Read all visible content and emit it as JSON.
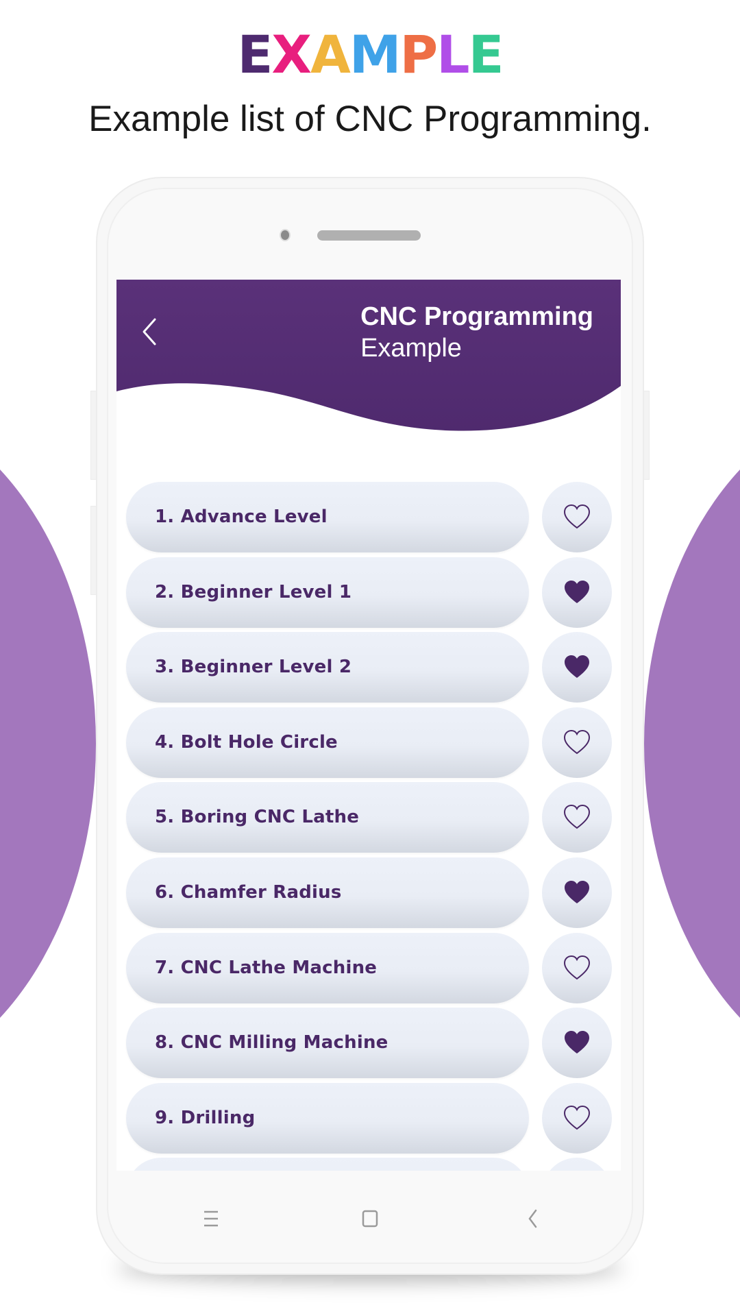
{
  "promo": {
    "title_letters": [
      {
        "char": "E",
        "color": "#4e2a6f"
      },
      {
        "char": "X",
        "color": "#e81f7e"
      },
      {
        "char": "A",
        "color": "#f0b43c"
      },
      {
        "char": "M",
        "color": "#3fa2e8"
      },
      {
        "char": "P",
        "color": "#ee6e45"
      },
      {
        "char": "L",
        "color": "#b04ee8"
      },
      {
        "char": "E",
        "color": "#35c991"
      }
    ],
    "subtitle": "Example list of CNC Programming."
  },
  "colors": {
    "header_purple": "#532b72",
    "accent_text": "#4a2867",
    "background_blob": "#a377bd",
    "pill_bg": "#eaeef6"
  },
  "app": {
    "header": {
      "back_icon": "chevron-left-icon",
      "title": "CNC Programming",
      "subtitle": "Example"
    },
    "list": [
      {
        "label": "1. Advance Level",
        "favorite": false
      },
      {
        "label": "2. Beginner Level 1",
        "favorite": true
      },
      {
        "label": "3. Beginner Level 2",
        "favorite": true
      },
      {
        "label": "4. Bolt Hole Circle",
        "favorite": false
      },
      {
        "label": "5. Boring CNC Lathe",
        "favorite": false
      },
      {
        "label": "6. Chamfer Radius",
        "favorite": true
      },
      {
        "label": "7. CNC Lathe Machine",
        "favorite": false
      },
      {
        "label": "8. CNC Milling Machine",
        "favorite": true
      },
      {
        "label": "9. Drilling",
        "favorite": false
      },
      {
        "label": "",
        "favorite": false
      }
    ]
  },
  "navbar": {
    "items": [
      {
        "icon": "menu-icon"
      },
      {
        "icon": "home-square-icon"
      },
      {
        "icon": "back-chevron-icon"
      }
    ]
  }
}
